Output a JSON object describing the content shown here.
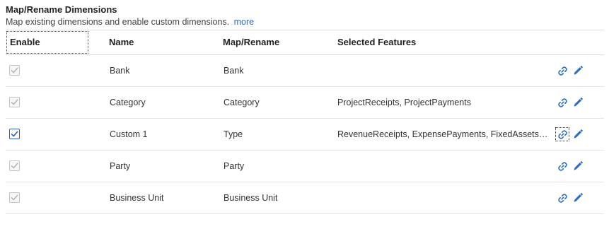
{
  "section": {
    "title": "Map/Rename Dimensions",
    "description": "Map existing dimensions and enable custom dimensions.",
    "more_link": "more"
  },
  "table": {
    "columns": {
      "enable": "Enable",
      "name": "Name",
      "map_rename": "Map/Rename",
      "selected_features": "Selected Features"
    },
    "rows": [
      {
        "enabled": true,
        "editable_checkbox": false,
        "name": "Bank",
        "map_rename": "Bank",
        "selected_features": ""
      },
      {
        "enabled": true,
        "editable_checkbox": false,
        "name": "Category",
        "map_rename": "Category",
        "selected_features": "ProjectReceipts, ProjectPayments"
      },
      {
        "enabled": true,
        "editable_checkbox": true,
        "name": "Custom 1",
        "map_rename": "Type",
        "selected_features": "RevenueReceipts, ExpensePayments, FixedAssetsPayments"
      },
      {
        "enabled": true,
        "editable_checkbox": false,
        "name": "Party",
        "map_rename": "Party",
        "selected_features": ""
      },
      {
        "enabled": true,
        "editable_checkbox": false,
        "name": "Business Unit",
        "map_rename": "Business Unit",
        "selected_features": ""
      }
    ],
    "row_actions": [
      "link-icon",
      "pencil-icon"
    ]
  },
  "colors": {
    "accent": "#2b6cc4",
    "checkbox_enabled": "#2b5fb5",
    "checkbox_disabled": "#b5b5b5"
  }
}
